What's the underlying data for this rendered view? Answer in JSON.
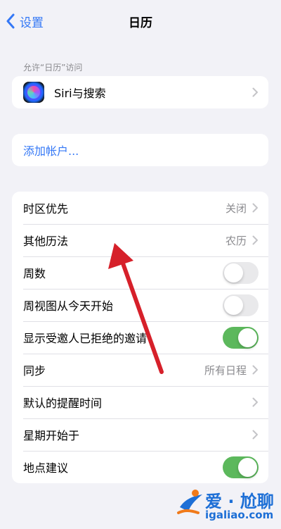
{
  "nav": {
    "back_label": "设置",
    "title": "日历"
  },
  "allow_section": {
    "header": "允许“日历”访问",
    "items": [
      {
        "label": "Siri与搜索",
        "icon": "siri-icon"
      }
    ]
  },
  "accounts": {
    "add_label": "添加帐户..."
  },
  "settings": {
    "items": [
      {
        "label": "时区优先",
        "value": "关闭",
        "type": "disclosure"
      },
      {
        "label": "其他历法",
        "value": "农历",
        "type": "disclosure"
      },
      {
        "label": "周数",
        "type": "toggle",
        "on": false
      },
      {
        "label": "周视图从今天开始",
        "type": "toggle",
        "on": false
      },
      {
        "label": "显示受邀人已拒绝的邀请",
        "type": "toggle",
        "on": true
      },
      {
        "label": "同步",
        "value": "所有日程",
        "type": "disclosure"
      },
      {
        "label": "默认的提醒时间",
        "value": "",
        "type": "disclosure"
      },
      {
        "label": "星期开始于",
        "value": "",
        "type": "disclosure"
      },
      {
        "label": "地点建议",
        "type": "toggle",
        "on": true
      }
    ]
  },
  "watermark": {
    "title": "爱 · 尬聊",
    "url": "igaliao.com"
  },
  "colors": {
    "accent": "#3478f6",
    "toggle_on": "#5cb85c",
    "toggle_off": "#e9e9eb",
    "annotation_arrow": "#d6202a",
    "background": "#f2f2f7"
  }
}
